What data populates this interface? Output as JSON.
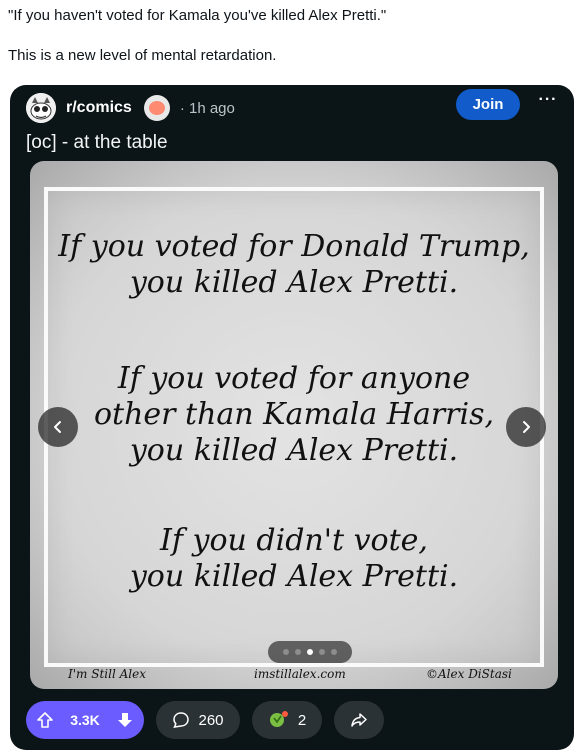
{
  "tweet": {
    "quote": "\"If you haven't voted for Kamala you've killed Alex Pretti.\"",
    "comment": "This is a new level of mental retardation."
  },
  "post": {
    "subreddit": "r/comics",
    "time": "1h ago",
    "separator": "·",
    "join_label": "Join",
    "more_label": "···",
    "title": "[oc] - at the table",
    "image": {
      "stanza1_line1": "If you voted for Donald Trump,",
      "stanza1_line2": "you killed Alex Pretti.",
      "stanza2_line1": "If you voted for anyone",
      "stanza2_line2": "other than Kamala Harris,",
      "stanza2_line3": "you killed Alex Pretti.",
      "stanza3_line1": "If you didn't vote,",
      "stanza3_line2": "you killed Alex Pretti.",
      "footer_left": "I'm Still Alex",
      "footer_center": "imstillalex.com",
      "footer_right": "©Alex DiStasi",
      "carousel_total": 5,
      "carousel_active": 3
    },
    "actions": {
      "upvotes": "3.3K",
      "comments": "260",
      "awards": "2"
    },
    "colors": {
      "card_bg": "#0b1416",
      "join": "#115bca",
      "vote": "#6a5cff",
      "pill": "#2a3236"
    },
    "icons": {
      "upvote": "arrow-up-icon",
      "downvote": "arrow-down-icon",
      "comment": "comment-bubble-icon",
      "award": "award-icon",
      "share": "share-arrow-icon",
      "prev": "chevron-left-icon",
      "next": "chevron-right-icon"
    }
  }
}
